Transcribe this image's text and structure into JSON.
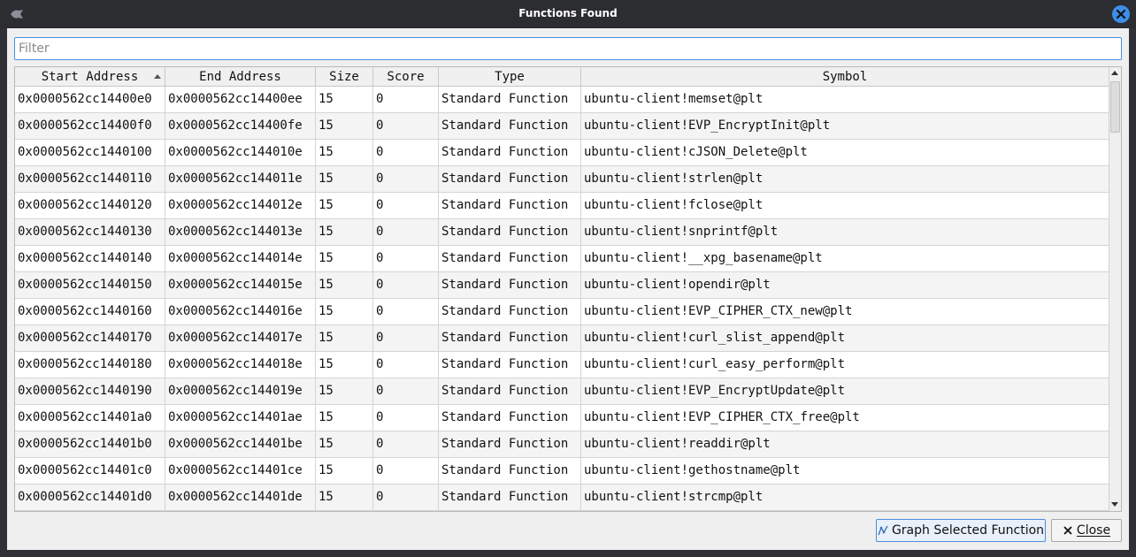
{
  "window": {
    "title": "Functions Found"
  },
  "filter": {
    "placeholder": "Filter",
    "value": ""
  },
  "table": {
    "columns": [
      "Start Address",
      "End Address",
      "Size",
      "Score",
      "Type",
      "Symbol"
    ],
    "sort_column": "Start Address",
    "sort_direction": "ascending",
    "rows": [
      [
        "0x0000562cc14400e0",
        "0x0000562cc14400ee",
        "15",
        "0",
        "Standard Function",
        "ubuntu-client!memset@plt"
      ],
      [
        "0x0000562cc14400f0",
        "0x0000562cc14400fe",
        "15",
        "0",
        "Standard Function",
        "ubuntu-client!EVP_EncryptInit@plt"
      ],
      [
        "0x0000562cc1440100",
        "0x0000562cc144010e",
        "15",
        "0",
        "Standard Function",
        "ubuntu-client!cJSON_Delete@plt"
      ],
      [
        "0x0000562cc1440110",
        "0x0000562cc144011e",
        "15",
        "0",
        "Standard Function",
        "ubuntu-client!strlen@plt"
      ],
      [
        "0x0000562cc1440120",
        "0x0000562cc144012e",
        "15",
        "0",
        "Standard Function",
        "ubuntu-client!fclose@plt"
      ],
      [
        "0x0000562cc1440130",
        "0x0000562cc144013e",
        "15",
        "0",
        "Standard Function",
        "ubuntu-client!snprintf@plt"
      ],
      [
        "0x0000562cc1440140",
        "0x0000562cc144014e",
        "15",
        "0",
        "Standard Function",
        "ubuntu-client!__xpg_basename@plt"
      ],
      [
        "0x0000562cc1440150",
        "0x0000562cc144015e",
        "15",
        "0",
        "Standard Function",
        "ubuntu-client!opendir@plt"
      ],
      [
        "0x0000562cc1440160",
        "0x0000562cc144016e",
        "15",
        "0",
        "Standard Function",
        "ubuntu-client!EVP_CIPHER_CTX_new@plt"
      ],
      [
        "0x0000562cc1440170",
        "0x0000562cc144017e",
        "15",
        "0",
        "Standard Function",
        "ubuntu-client!curl_slist_append@plt"
      ],
      [
        "0x0000562cc1440180",
        "0x0000562cc144018e",
        "15",
        "0",
        "Standard Function",
        "ubuntu-client!curl_easy_perform@plt"
      ],
      [
        "0x0000562cc1440190",
        "0x0000562cc144019e",
        "15",
        "0",
        "Standard Function",
        "ubuntu-client!EVP_EncryptUpdate@plt"
      ],
      [
        "0x0000562cc14401a0",
        "0x0000562cc14401ae",
        "15",
        "0",
        "Standard Function",
        "ubuntu-client!EVP_CIPHER_CTX_free@plt"
      ],
      [
        "0x0000562cc14401b0",
        "0x0000562cc14401be",
        "15",
        "0",
        "Standard Function",
        "ubuntu-client!readdir@plt"
      ],
      [
        "0x0000562cc14401c0",
        "0x0000562cc14401ce",
        "15",
        "0",
        "Standard Function",
        "ubuntu-client!gethostname@plt"
      ],
      [
        "0x0000562cc14401d0",
        "0x0000562cc14401de",
        "15",
        "0",
        "Standard Function",
        "ubuntu-client!strcmp@plt"
      ]
    ]
  },
  "buttons": {
    "graph_label": "Graph Selected Function",
    "close_label": "Close"
  },
  "colors": {
    "accent": "#4b8fd6",
    "titlebar": "#2b2d31",
    "close_button": "#3d8ee8"
  },
  "icons": {
    "app": "app-logo-icon",
    "window_close": "close-icon",
    "graph": "graph-icon",
    "close_button": "x-icon"
  }
}
